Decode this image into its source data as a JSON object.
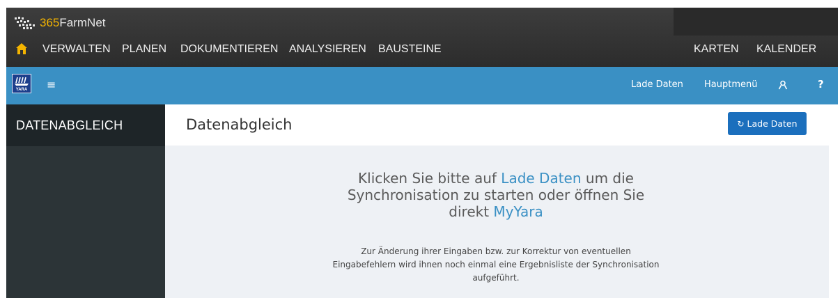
{
  "topbar": {
    "brand_number": "365",
    "brand_name": "FarmNet",
    "nav": [
      "VERWALTEN",
      "PLANEN",
      "DOKUMENTIEREN",
      "ANALYSIEREN",
      "BAUSTEINE"
    ],
    "nav_right": [
      "KARTEN",
      "KALENDER"
    ]
  },
  "appbar": {
    "logo_text": "YARA",
    "hamburger": "≡",
    "links": [
      "Lade Daten",
      "Hauptmenü"
    ],
    "help": "?"
  },
  "sidebar": {
    "title": "DATENABGLEICH"
  },
  "main": {
    "title": "Datenabgleich",
    "load_button": "Lade Daten",
    "message": {
      "part1": "Klicken Sie bitte auf ",
      "link1": "Lade Daten",
      "part2": " um die Synchronisation zu starten oder öffnen Sie direkt ",
      "link2": "MyYara"
    },
    "hint": "Zur Änderung ihrer Eingaben bzw. zur Korrektur von eventuellen Eingabefehlern wird ihnen noch einmal eine Ergebnisliste der Synchronisation aufgeführt."
  },
  "colors": {
    "topbar": "#333333",
    "accent_yellow": "#f4b400",
    "appbar_blue": "#3a90c4",
    "button_blue": "#1b6fbd",
    "sidebar": "#2c3437",
    "content_bg": "#eef1f5"
  }
}
